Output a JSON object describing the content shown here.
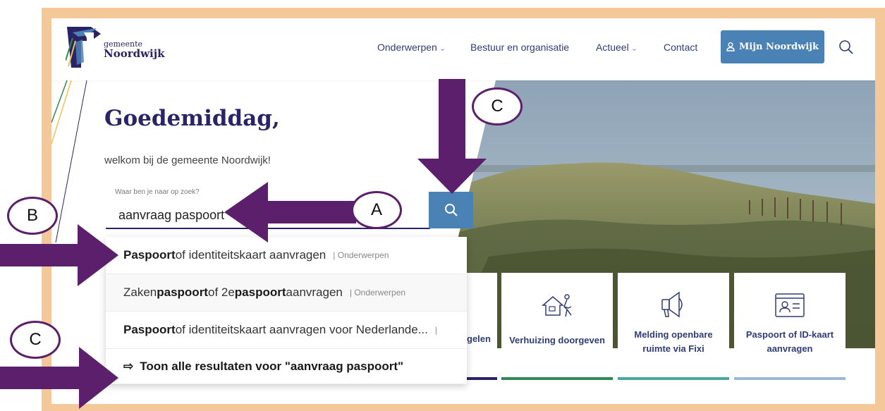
{
  "header": {
    "logo_line1": "gemeente",
    "logo_line2": "Noordwijk",
    "nav": [
      {
        "label": "Onderwerpen",
        "has_dropdown": true
      },
      {
        "label": "Bestuur en organisatie",
        "has_dropdown": false
      },
      {
        "label": "Actueel",
        "has_dropdown": true
      },
      {
        "label": "Contact",
        "has_dropdown": false
      }
    ],
    "mijn_button": "Mijn Noordwijk",
    "search_icon": "search-icon"
  },
  "hero": {
    "greeting": "Goedemiddag,",
    "welcome": "welkom bij de gemeente Noordwijk!",
    "search_label": "Waar ben je naar op zoek?",
    "search_value": "aanvraag paspoort"
  },
  "suggestions": [
    {
      "bold_prefix": "Paspoort",
      "rest": " of identiteitskaart aanvragen",
      "category": "| Onderwerpen"
    },
    {
      "pre": "Zaken",
      "bold1": "paspoort",
      "mid": " of 2e ",
      "bold2": "paspoort",
      "post": " aanvragen",
      "category": "| Onderwerpen"
    },
    {
      "bold_prefix": "Paspoort",
      "rest": " of identiteitskaart aanvragen voor Nederlande...",
      "category": "|"
    }
  ],
  "show_all": {
    "arrow": "⇨",
    "label": "Toon alle resultaten voor \"aanvraag paspoort\""
  },
  "cards": [
    {
      "label": "gelen",
      "bar_color": "#2a2466",
      "icon": "none"
    },
    {
      "label": "Verhuizing doorgeven",
      "bar_color": "#2e8a57",
      "icon": "house-moving-icon"
    },
    {
      "label": "Melding openbare ruimte via Fixi",
      "bar_color": "#49a6a0",
      "icon": "megaphone-icon"
    },
    {
      "label": "Paspoort of ID-kaart aanvragen",
      "bar_color": "#9bb8d6",
      "icon": "id-card-icon"
    }
  ],
  "annotations": {
    "a": "A",
    "b": "B",
    "c1": "C",
    "c2": "C",
    "color": "#5b1f6b"
  },
  "colors": {
    "frame": "#f5c89a",
    "brand_navy": "#2a2466",
    "button_blue": "#4b82b6"
  }
}
